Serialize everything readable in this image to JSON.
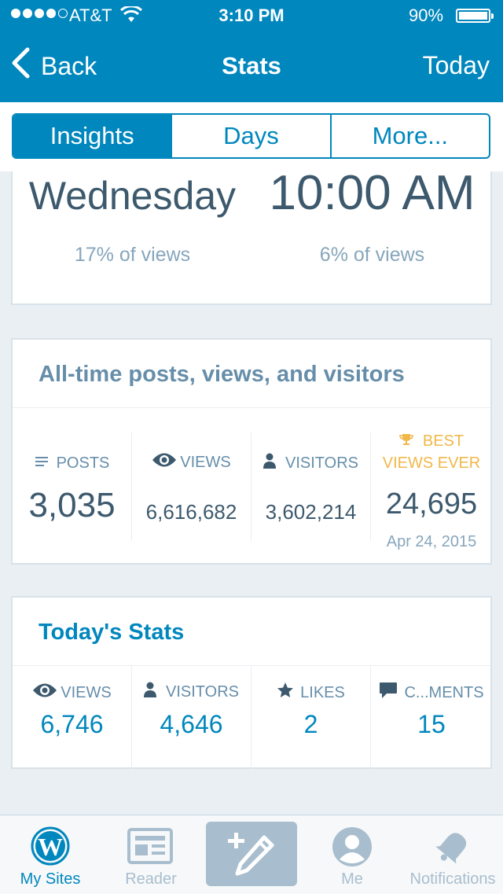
{
  "status": {
    "carrier": "AT&T",
    "time": "3:10 PM",
    "battery": "90%"
  },
  "nav": {
    "back": "Back",
    "title": "Stats",
    "right": "Today"
  },
  "tabs": [
    "Insights",
    "Days",
    "More..."
  ],
  "popular": {
    "day": "Wednesday",
    "day_sub": "17% of views",
    "hour": "10:00 AM",
    "hour_sub": "6% of views"
  },
  "alltime": {
    "title": "All-time posts, views, and visitors",
    "posts_label": "POSTS",
    "posts": "3,035",
    "views_label": "VIEWS",
    "views": "6,616,682",
    "visitors_label": "VISITORS",
    "visitors": "3,602,214",
    "best_label_1": "BEST",
    "best_label_2": "VIEWS EVER",
    "best": "24,695",
    "best_date": "Apr 24, 2015"
  },
  "today": {
    "title": "Today's Stats",
    "views_label": "VIEWS",
    "views": "6,746",
    "visitors_label": "VISITORS",
    "visitors": "4,646",
    "likes_label": "LIKES",
    "likes": "2",
    "comments_label": "C...MENTS",
    "comments": "15"
  },
  "tabbar": {
    "mysites": "My Sites",
    "reader": "Reader",
    "me": "Me",
    "notifications": "Notifications"
  },
  "colors": {
    "brand": "#0087be",
    "accent": "#f0b849",
    "dark_text": "#3d596d",
    "muted_text": "#87a6bc",
    "background": "#e9eff3"
  }
}
